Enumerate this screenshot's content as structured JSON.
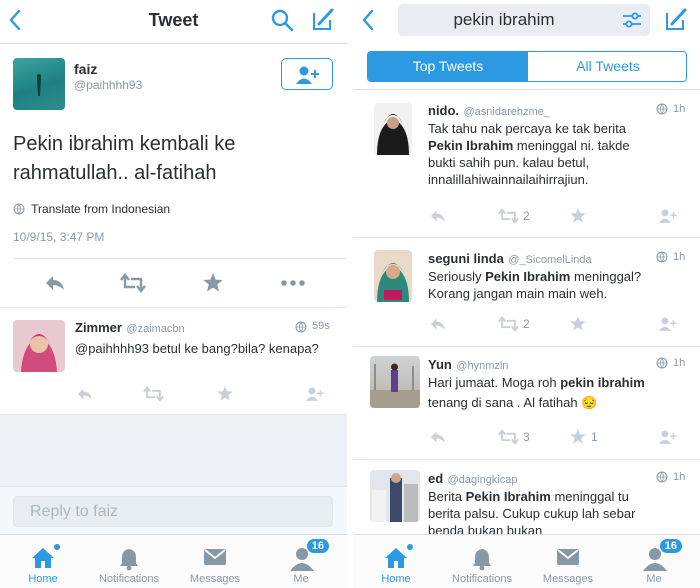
{
  "left": {
    "nav": {
      "title": "Tweet"
    },
    "tweet": {
      "name": "faiz",
      "handle": "@paihhhh93",
      "text": "Pekin ibrahim kembali ke rahmatullah.. al-fatihah",
      "translate": "Translate from Indonesian",
      "timestamp": "10/9/15, 3:47 PM"
    },
    "reply": {
      "name": "Zimmer",
      "handle": "@zaimacbn",
      "time": "59s",
      "text": "@paihhhh93 betul ke bang?bila? kenapa?"
    },
    "composer": {
      "placeholder": "Reply to faiz"
    }
  },
  "right": {
    "search": {
      "query": "pekin ibrahim"
    },
    "segments": {
      "top": "Top Tweets",
      "all": "All Tweets"
    },
    "tweets": [
      {
        "name": "nido.",
        "handle": "@asnidarehzme_",
        "time": "1h",
        "text_a": "Tak tahu nak percaya ke tak berita",
        "text_b1": "Pekin Ibrahim",
        "text_b2": " meninggal ni. takde",
        "text_c": "bukti sahih pun. kalau betul,",
        "text_d": "innalillahiwainnailaihirrajiun.",
        "retweets": "2",
        "favorites": ""
      },
      {
        "name": "seguni linda",
        "handle": "@_SicomelLinda",
        "time": "1h",
        "text_a1": "Seriously ",
        "text_a2": "Pekin Ibrahim",
        "text_a3": " meninggal?",
        "text_b": "Korang jangan main main weh.",
        "retweets": "2",
        "favorites": ""
      },
      {
        "name": "Yun",
        "handle": "@hynmzln",
        "time": "1h",
        "text_a1": "Hari jumaat. Moga roh ",
        "text_a2": "pekin ibrahim",
        "text_b": "tenang di sana . Al fatihah 😔",
        "retweets": "3",
        "favorites": "1"
      },
      {
        "name": "ed",
        "handle": "@dagingkicap",
        "time": "1h",
        "text_a1": "Berita ",
        "text_a2": "Pekin Ibrahim",
        "text_a3": " meninggal tu",
        "text_b": "berita palsu. Cukup cukup lah sebar",
        "text_c": "benda bukan bukan"
      }
    ]
  },
  "tabbar": {
    "home": "Home",
    "notifications": "Notifications",
    "messages": "Messages",
    "me": "Me",
    "me_badge": "16"
  },
  "colors": {
    "accent": "#2b9ae3",
    "muted": "#8899a6",
    "text": "#292f33"
  }
}
